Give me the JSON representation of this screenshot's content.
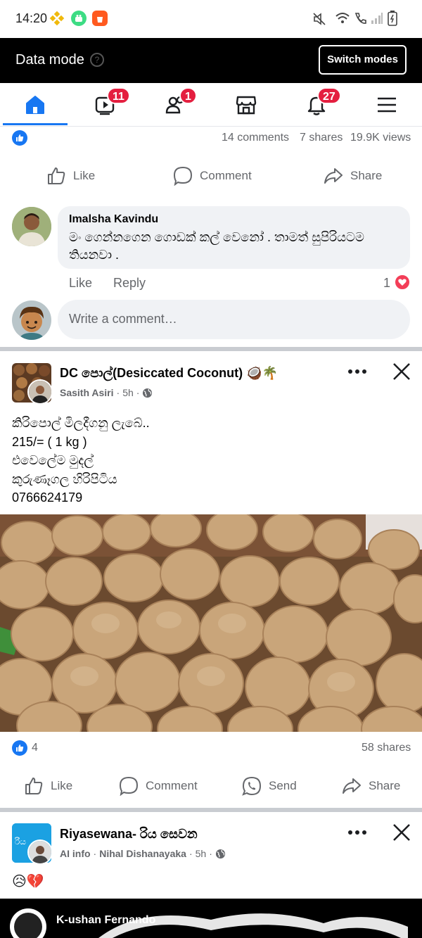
{
  "status_bar": {
    "time": "14:20"
  },
  "data_mode": {
    "title": "Data mode",
    "switch_label": "Switch modes"
  },
  "nav": {
    "items": [
      {
        "name": "home",
        "badge": ""
      },
      {
        "name": "watch",
        "badge": "11"
      },
      {
        "name": "friends",
        "badge": "1"
      },
      {
        "name": "marketplace",
        "badge": ""
      },
      {
        "name": "notifications",
        "badge": "27"
      },
      {
        "name": "menu",
        "badge": ""
      }
    ],
    "active": "home"
  },
  "post1": {
    "stats": {
      "comments": "14 comments",
      "shares": "7 shares",
      "views": "19.9K views"
    },
    "actions": {
      "like": "Like",
      "comment": "Comment",
      "share": "Share"
    },
    "comment": {
      "author": "Imalsha Kavindu",
      "text": "මං ගෙන්නගෙන ගොඩක් කල් වෙනෝ . තාමත් සුපිරියටම තියනවා .",
      "like": "Like",
      "reply": "Reply",
      "reaction_count": "1"
    },
    "write_placeholder": "Write a comment…"
  },
  "post2": {
    "title": "DC පොල්(Desiccated Coconut) 🥥🌴",
    "author": "Sasith Asiri",
    "time": "5h",
    "body": [
      "කිරිපොල් මිලදීගනු ලැබේ..",
      "215/= ( 1 kg )",
      "එවෙලේම මුදල්",
      "කුරුණෑගල හිරිපිටිය",
      "0766624179"
    ],
    "reaction_count": "4",
    "shares": "58 shares",
    "actions": {
      "like": "Like",
      "comment": "Comment",
      "send": "Send",
      "share": "Share"
    }
  },
  "post3": {
    "title": "Riyasewana- රිය සෙවන",
    "badge": "AI info",
    "author": "Nihal Dishanayaka",
    "time": "5h",
    "body": "😥💔",
    "image_overlay_name": "K-ushan Fernando"
  },
  "colors": {
    "accent": "#1877f2",
    "badge": "#e41e3f",
    "love": "#f33e58"
  }
}
